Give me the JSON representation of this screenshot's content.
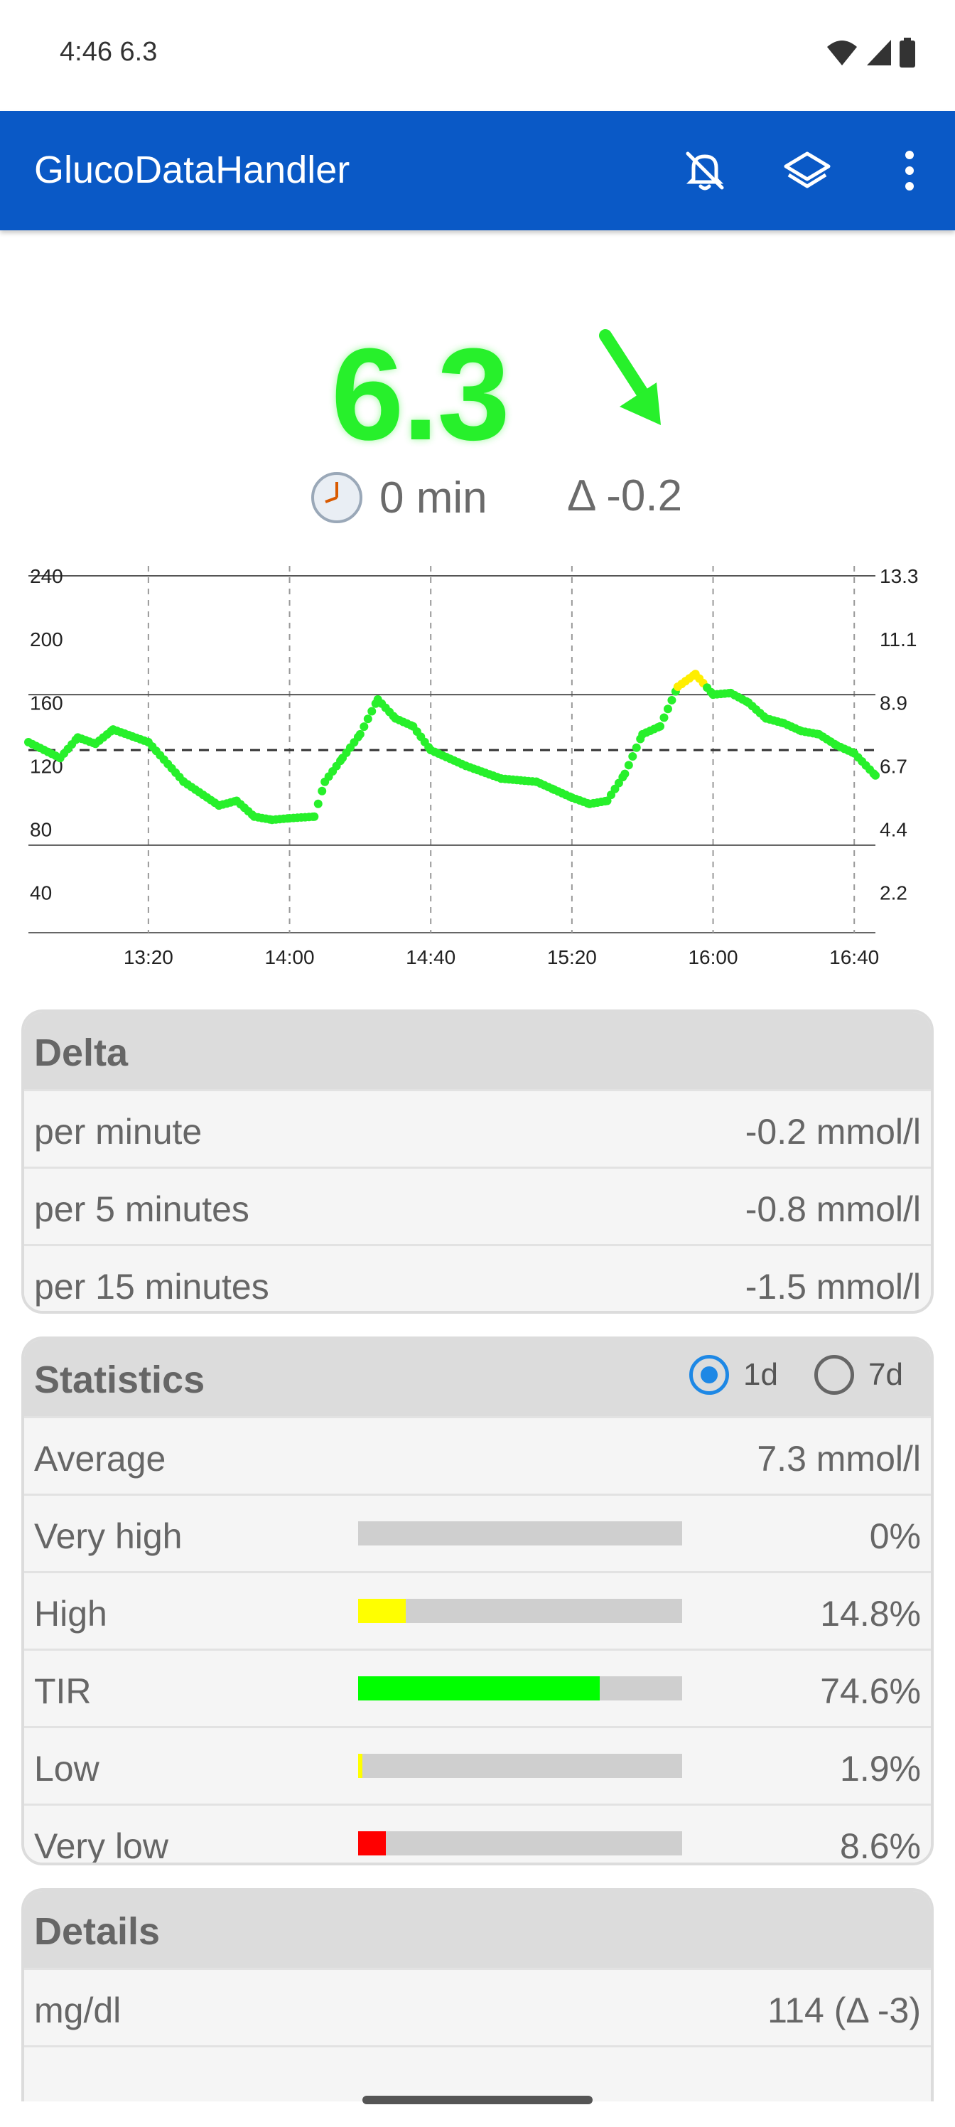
{
  "status": {
    "time": "4:46",
    "glucose": "6.3"
  },
  "app": {
    "title": "GlucoDataHandler"
  },
  "icons": {
    "mute": "bell-off-icon",
    "layers": "layers-icon",
    "menu": "more-vert-icon",
    "trend": "arrow-down-right-icon",
    "clock": "clock-icon"
  },
  "current": {
    "value": "6.3",
    "time_ago": "0 min",
    "delta": "Δ -0.2",
    "color": "#27f02b"
  },
  "chart_data": {
    "type": "line",
    "y_left_ticks": [
      "240",
      "200",
      "160",
      "120",
      "80",
      "40"
    ],
    "y_right_ticks": [
      "13.3",
      "11.1",
      "8.9",
      "6.7",
      "4.4",
      "2.2"
    ],
    "x_ticks": [
      "13:20",
      "14:00",
      "14:40",
      "15:20",
      "16:00",
      "16:40"
    ],
    "ylim": [
      30,
      240
    ],
    "xlim": [
      "12:46",
      "16:46"
    ],
    "lines": {
      "upper": 165,
      "lower": 70,
      "target": 130
    },
    "series": [
      {
        "x": [
          "12:46",
          "12:55",
          "13:00",
          "13:05",
          "13:10",
          "13:20",
          "13:30",
          "13:40",
          "13:45",
          "13:50",
          "13:55",
          "14:00",
          "14:07",
          "14:10",
          "14:15",
          "14:20",
          "14:25",
          "14:30",
          "14:35",
          "14:40",
          "14:50",
          "15:00",
          "15:10",
          "15:15",
          "15:20",
          "15:25",
          "15:30",
          "15:35",
          "15:40",
          "15:45",
          "15:50",
          "15:55",
          "16:00",
          "16:05",
          "16:10",
          "16:15",
          "16:20",
          "16:25",
          "16:30",
          "16:35",
          "16:40",
          "16:46"
        ],
        "y": [
          135,
          125,
          138,
          134,
          143,
          135,
          110,
          95,
          98,
          88,
          86,
          87,
          88,
          110,
          125,
          140,
          162,
          150,
          145,
          130,
          120,
          112,
          110,
          105,
          100,
          96,
          98,
          115,
          140,
          145,
          170,
          178,
          165,
          166,
          160,
          150,
          147,
          142,
          140,
          133,
          128,
          114
        ]
      }
    ],
    "point_colors": {
      "normal": "#27f02b",
      "high": "#ffee00"
    }
  },
  "delta_panel": {
    "title": "Delta",
    "rows": [
      {
        "label": "per minute",
        "value": "-0.2 mmol/l"
      },
      {
        "label": "per 5 minutes",
        "value": "-0.8 mmol/l"
      },
      {
        "label": "per 15 minutes",
        "value": "-1.5 mmol/l"
      }
    ]
  },
  "stats_panel": {
    "title": "Statistics",
    "range_1d": "1d",
    "range_7d": "7d",
    "selected": "1d",
    "average_label": "Average",
    "average_value": "7.3 mmol/l",
    "rows": [
      {
        "label": "Very high",
        "value": "0%",
        "fraction": 0.0,
        "color": "#c00000"
      },
      {
        "label": "High",
        "value": "14.8%",
        "fraction": 0.148,
        "color": "#ffff00"
      },
      {
        "label": "TIR",
        "value": "74.6%",
        "fraction": 0.746,
        "color": "#00ff00"
      },
      {
        "label": "Low",
        "value": "1.9%",
        "fraction": 0.019,
        "color": "#ffff00"
      },
      {
        "label": "Very low",
        "value": "8.6%",
        "fraction": 0.086,
        "color": "#ff0000"
      }
    ]
  },
  "details_panel": {
    "title": "Details",
    "rows": [
      {
        "label": "mg/dl",
        "value": "114 (Δ -3)"
      }
    ]
  }
}
